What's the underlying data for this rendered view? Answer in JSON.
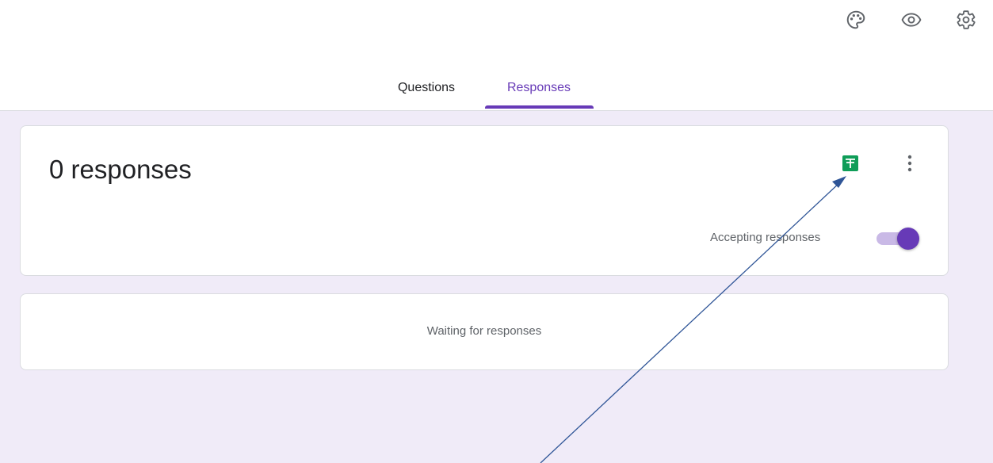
{
  "header": {
    "icons": [
      "palette-icon",
      "eye-icon",
      "gear-icon"
    ]
  },
  "tabs": [
    {
      "label": "Questions",
      "active": false
    },
    {
      "label": "Responses",
      "active": true
    }
  ],
  "summary": {
    "count_text": "0 responses",
    "accepting_label": "Accepting responses",
    "accepting": true
  },
  "waiting": {
    "text": "Waiting for responses"
  },
  "colors": {
    "accent": "#673ab7",
    "background": "#f0ebf8",
    "sheets_green": "#0f9d58",
    "annotation_arrow": "#2f5597"
  }
}
